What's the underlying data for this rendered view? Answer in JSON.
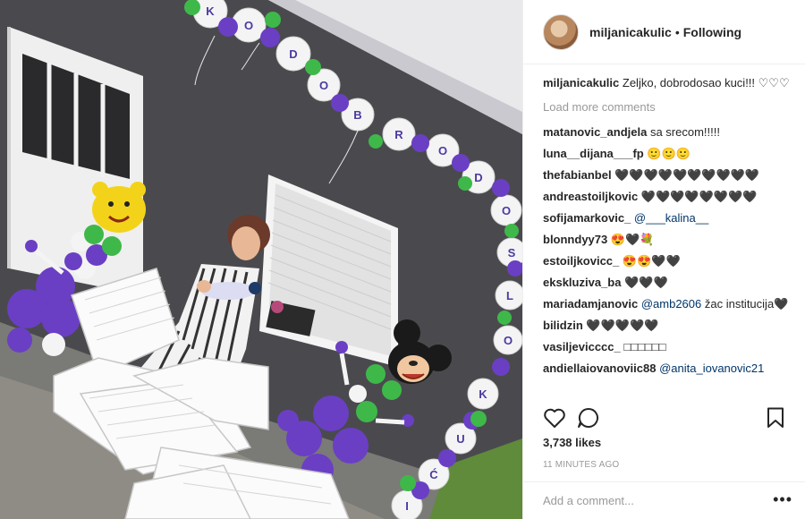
{
  "post": {
    "username": "miljanicakulic",
    "separator": "•",
    "follow_status": "Following",
    "caption_user": "miljanicakulic",
    "caption_text": "Zeljko, dobrodosao kuci!!! ♡♡♡",
    "load_more": "Load more comments",
    "likes": "3,738 likes",
    "timestamp": "11 MINUTES AGO",
    "add_comment_placeholder": "Add a comment...",
    "more_glyph": "•••"
  },
  "comments": [
    {
      "user": "matanovic_andjela",
      "text": "sa srecom!!!!!"
    },
    {
      "user": "luna__dijana___fp",
      "text": "🙂🙂🙂"
    },
    {
      "user": "thefabianbel",
      "text": "🖤🖤🖤🖤🖤🖤🖤🖤🖤🖤"
    },
    {
      "user": "andreastoiljkovic",
      "text": "🖤🖤🖤🖤🖤🖤🖤🖤"
    },
    {
      "user": "sofijamarkovic_",
      "text": "@___kalina__",
      "mention": true
    },
    {
      "user": "blonndyy73",
      "text": "😍🖤💐"
    },
    {
      "user": "estoiljkovicc_",
      "text": "😍😍🖤🖤"
    },
    {
      "user": "ekskluziva_ba",
      "text": "🖤🖤🖤"
    },
    {
      "user": "mariadamjanovic",
      "text": "@amb2606",
      "mention": true,
      "text2": " žac institucija🖤"
    },
    {
      "user": "bilidzin",
      "text": "🖤🖤🖤🖤🖤"
    },
    {
      "user": "vasiljevicccc_",
      "text": "□□□□□□"
    },
    {
      "user": "andiellaiovanoviic88",
      "text": "@anita_iovanovic21",
      "mention": true
    }
  ],
  "icons": {
    "like": "heart-icon",
    "comment": "comment-bubble-icon",
    "save": "bookmark-icon",
    "more": "more-options-icon"
  },
  "balloon_letters": [
    "K",
    "O",
    "D",
    "O",
    "B",
    "R",
    "O",
    "D",
    "O",
    "S",
    "L",
    "O",
    "K",
    "U",
    "Ć",
    "I"
  ],
  "colors": {
    "wall": "#4a4a4e",
    "purple_balloon": "#6a3fc4",
    "green_balloon": "#3fb84a",
    "white_balloon": "#f4f4f4",
    "link": "#003569",
    "muted": "#999999"
  }
}
